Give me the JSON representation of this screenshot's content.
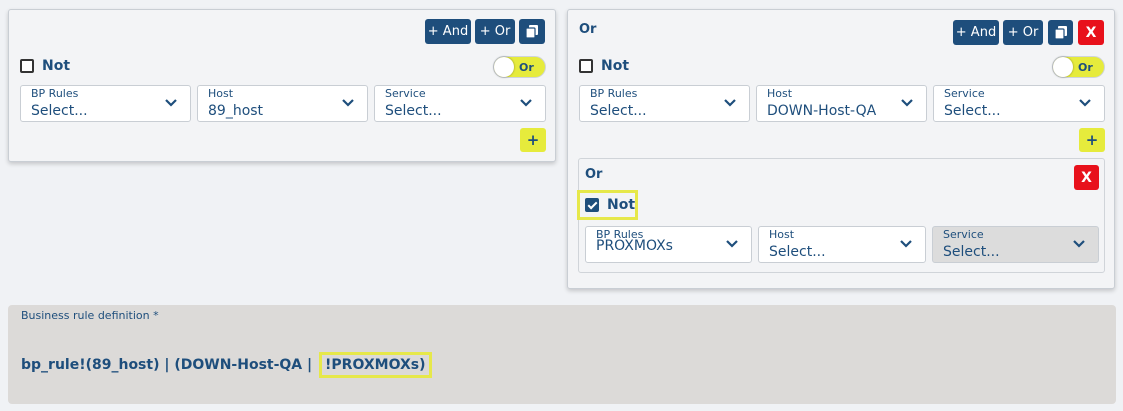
{
  "colors": {
    "primary": "#1e4e7c",
    "danger": "#e8111b",
    "accent": "#e6eb3c",
    "highlight": "#e6e84a"
  },
  "left_panel": {
    "and_label": "+ And",
    "or_label": "+ Or",
    "copy_icon": "copy-icon",
    "not_label": "Not",
    "toggle_label": "Or",
    "fields": [
      {
        "label": "BP Rules",
        "value": "Select..."
      },
      {
        "label": "Host",
        "value": "89_host"
      },
      {
        "label": "Service",
        "value": "Select..."
      }
    ],
    "add_label": "+"
  },
  "right_panel": {
    "title": "Or",
    "and_label": "+ And",
    "or_label": "+ Or",
    "delete_label": "X",
    "not_label": "Not",
    "toggle_label": "Or",
    "fields": [
      {
        "label": "BP Rules",
        "value": "Select..."
      },
      {
        "label": "Host",
        "value": "DOWN-Host-QA"
      },
      {
        "label": "Service",
        "value": "Select..."
      }
    ],
    "add_label": "+",
    "sub": {
      "title": "Or",
      "delete_label": "X",
      "not_label": "Not",
      "not_checked": true,
      "fields": [
        {
          "label": "BP Rules",
          "value": "PROXMOXs"
        },
        {
          "label": "Host",
          "value": "Select..."
        },
        {
          "label": "Service",
          "value": "Select..."
        }
      ]
    }
  },
  "definition": {
    "label": "Business rule definition *",
    "value_prefix": "bp_rule!(89_host) | (DOWN-Host-QA | ",
    "value_highlight": "!PROXMOXs)"
  }
}
